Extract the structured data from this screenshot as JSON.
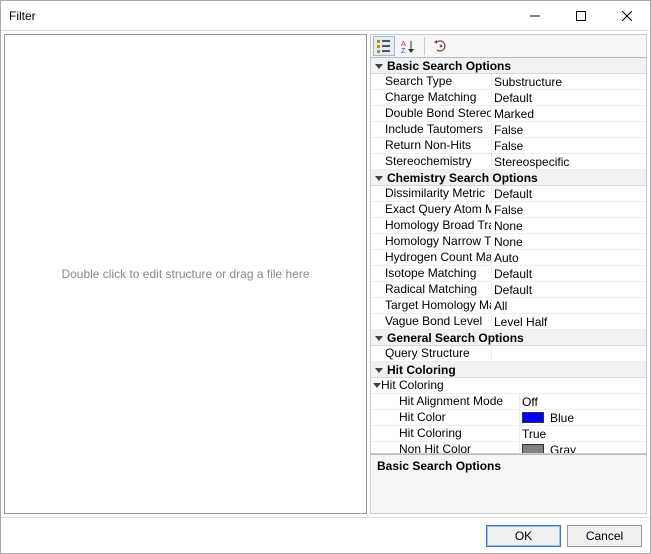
{
  "window": {
    "title": "Filter"
  },
  "leftPanel": {
    "placeholder": "Double click to edit structure or drag a file here"
  },
  "toolbar": {
    "categorized_icon": "categorized-icon",
    "sort_icon": "sort-alpha-icon",
    "pages_icon": "property-pages-icon"
  },
  "categories": {
    "basic": {
      "label": "Basic Search Options",
      "rows": [
        {
          "name": "Search Type",
          "value": "Substructure"
        },
        {
          "name": "Charge Matching",
          "value": "Default"
        },
        {
          "name": "Double Bond Stereo Checking",
          "value": "Marked"
        },
        {
          "name": "Include Tautomers",
          "value": "False"
        },
        {
          "name": "Return Non-Hits",
          "value": "False"
        },
        {
          "name": "Stereochemistry",
          "value": "Stereospecific"
        }
      ]
    },
    "chemistry": {
      "label": "Chemistry Search Options",
      "rows": [
        {
          "name": "Dissimilarity Metric",
          "value": "Default"
        },
        {
          "name": "Exact Query Atom Matching",
          "value": "False"
        },
        {
          "name": "Homology Broad Translation",
          "value": "None"
        },
        {
          "name": "Homology Narrow Translation",
          "value": "None"
        },
        {
          "name": "Hydrogen Count Matching",
          "value": "Auto"
        },
        {
          "name": "Isotope Matching",
          "value": "Default"
        },
        {
          "name": "Radical Matching",
          "value": "Default"
        },
        {
          "name": "Target Homology Matching",
          "value": "All"
        },
        {
          "name": "Vague Bond Level",
          "value": "Level Half"
        }
      ]
    },
    "general": {
      "label": "General Search Options",
      "rows": [
        {
          "name": "Query Structure",
          "value": ""
        }
      ]
    },
    "hitColoring": {
      "label": "Hit Coloring",
      "subLabel": "Hit Coloring",
      "rows": [
        {
          "name": "Hit Alignment Mode",
          "value": "Off"
        },
        {
          "name": "Hit Color",
          "value": "Blue",
          "swatch": "#0000ff"
        },
        {
          "name": "Hit Coloring",
          "value": "True"
        },
        {
          "name": "Non Hit Color",
          "value": "Gray",
          "swatch": "#808080"
        }
      ]
    }
  },
  "description": {
    "title": "Basic Search Options"
  },
  "footer": {
    "ok": "OK",
    "cancel": "Cancel"
  }
}
